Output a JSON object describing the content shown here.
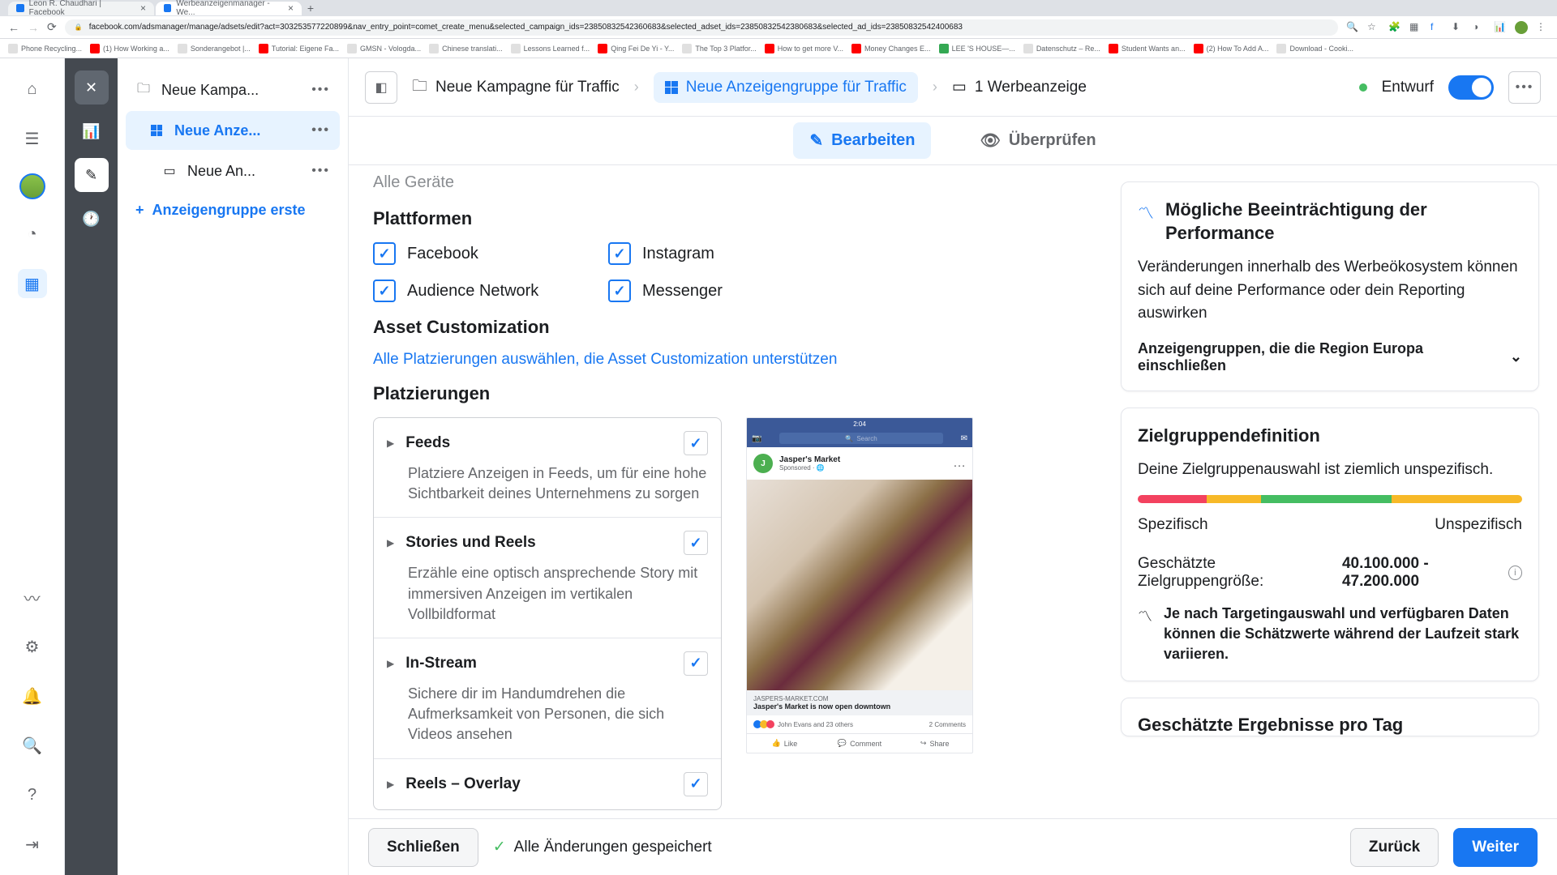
{
  "browser": {
    "tabs": [
      {
        "title": "Leon R. Chaudhari | Facebook"
      },
      {
        "title": "Werbeanzeigenmanager - We..."
      }
    ],
    "url": "facebook.com/adsmanager/manage/adsets/edit?act=303253577220899&nav_entry_point=comet_create_menu&selected_campaign_ids=23850832542360683&selected_adset_ids=23850832542380683&selected_ad_ids=23850832542400683",
    "bookmarks": [
      "Phone Recycling...",
      "(1) How Working a...",
      "Sonderangebot |...",
      "Tutorial: Eigene Fa...",
      "GMSN - Vologda...",
      "Chinese translati...",
      "Lessons Learned f...",
      "Qing Fei De Yi - Y...",
      "The Top 3 Platfor...",
      "How to get more V...",
      "Money Changes E...",
      "LEE 'S HOUSE—...",
      "Datenschutz – Re...",
      "Student Wants an...",
      "(2) How To Add A...",
      "Download - Cooki..."
    ]
  },
  "tree": {
    "campaign": "Neue Kampa...",
    "adset": "Neue Anze...",
    "ad": "Neue An...",
    "add": "Anzeigengruppe erste"
  },
  "breadcrumb": {
    "campaign": "Neue Kampagne für Traffic",
    "adset": "Neue Anzeigengruppe für Traffic",
    "ad": "1 Werbeanzeige",
    "status": "Entwurf"
  },
  "tabs": {
    "edit": "Bearbeiten",
    "review": "Überprüfen"
  },
  "form": {
    "devices": "Alle Geräte",
    "platforms_title": "Plattformen",
    "platforms": {
      "fb": "Facebook",
      "ig": "Instagram",
      "an": "Audience Network",
      "msg": "Messenger"
    },
    "asset_title": "Asset Customization",
    "asset_link": "Alle Platzierungen auswählen, die Asset Customization unterstützen",
    "placements_title": "Platzierungen",
    "placements": [
      {
        "name": "Feeds",
        "desc": "Platziere Anzeigen in Feeds, um für eine hohe Sichtbarkeit deines Unternehmens zu sorgen"
      },
      {
        "name": "Stories und Reels",
        "desc": "Erzähle eine optisch ansprechende Story mit immersiven Anzeigen im vertikalen Vollbildformat"
      },
      {
        "name": "In-Stream",
        "desc": "Sichere dir im Handumdrehen die Aufmerksamkeit von Personen, die sich Videos ansehen"
      },
      {
        "name": "Reels – Overlay",
        "desc": ""
      }
    ]
  },
  "preview": {
    "time": "2:04",
    "search": "Search",
    "page": "Jasper's Market",
    "sponsored": "Sponsored · 🌐",
    "domain": "JASPERS-MARKET.COM",
    "headline": "Jasper's Market is now open downtown",
    "likes": "John Evans and 23 others",
    "comments": "2 Comments",
    "actions": {
      "like": "Like",
      "comment": "Comment",
      "share": "Share"
    }
  },
  "side": {
    "perf_title": "Mögliche Beeinträchtigung der Performance",
    "perf_text": "Veränderungen innerhalb des Werbeökosystem können sich auf deine Performance oder dein Reporting auswirken",
    "perf_collapse": "Anzeigengruppen, die die Region Europa einschließen",
    "audience_title": "Zielgruppendefinition",
    "audience_text": "Deine Zielgruppenauswahl ist ziemlich unspezifisch.",
    "specific": "Spezifisch",
    "unspecific": "Unspezifisch",
    "est_label": "Geschätzte Zielgruppengröße:",
    "est_value": "40.100.000 - 47.200.000",
    "note": "Je nach Targetingauswahl und verfügbaren Daten können die Schätzwerte während der Laufzeit stark variieren.",
    "next_card": "Geschätzte Ergebnisse pro Tag"
  },
  "footer": {
    "close": "Schließen",
    "saved": "Alle Änderungen gespeichert",
    "back": "Zurück",
    "next": "Weiter"
  }
}
